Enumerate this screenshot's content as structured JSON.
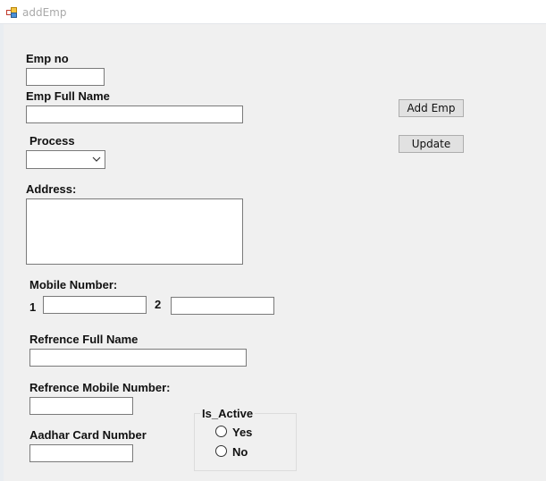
{
  "window": {
    "title": "addEmp",
    "icon": "form-app-icon"
  },
  "form": {
    "emp_no": {
      "label": "Emp no",
      "value": ""
    },
    "emp_full_name": {
      "label": "Emp Full Name",
      "value": ""
    },
    "process": {
      "label": "Process",
      "selected": ""
    },
    "address": {
      "label": "Address:",
      "value": ""
    },
    "mobile": {
      "label": "Mobile Number:",
      "num1_label": "1",
      "num1_value": "",
      "num2_label": "2",
      "num2_value": ""
    },
    "reference_full_name": {
      "label": "Refrence Full Name",
      "value": ""
    },
    "reference_mobile": {
      "label": "Refrence Mobile Number:",
      "value": ""
    },
    "aadhar": {
      "label": "Aadhar Card Number",
      "value": ""
    }
  },
  "is_active": {
    "title": "Is_Active",
    "options": [
      {
        "label": "Yes",
        "checked": false
      },
      {
        "label": "No",
        "checked": false
      }
    ]
  },
  "buttons": {
    "add_emp": "Add Emp",
    "update": "Update"
  }
}
